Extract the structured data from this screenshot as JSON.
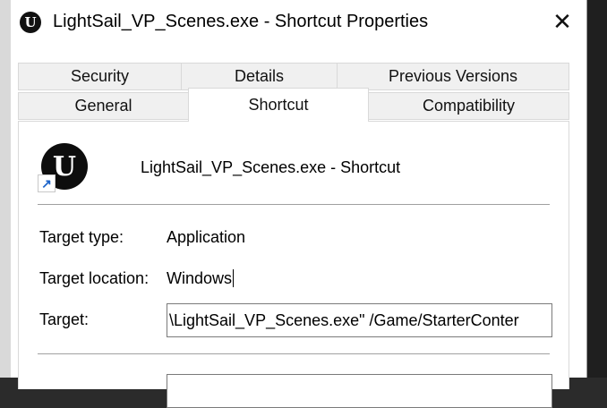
{
  "window": {
    "title": "LightSail_VP_Scenes.exe - Shortcut Properties",
    "close_glyph": "✕"
  },
  "tabs": {
    "row1": [
      "Security",
      "Details",
      "Previous Versions"
    ],
    "row2": [
      "General",
      "Shortcut",
      "Compatibility"
    ],
    "active": "Shortcut"
  },
  "shortcut": {
    "name": "LightSail_VP_Scenes.exe - Shortcut",
    "icon": "unreal-engine-icon",
    "overlay_icon": "shortcut-arrow-icon"
  },
  "fields": {
    "target_type_label": "Target type:",
    "target_type_value": "Application",
    "target_location_label": "Target location:",
    "target_location_value": "Windows",
    "target_label": "Target:",
    "target_value": "\\LightSail_VP_Scenes.exe\" /Game/StarterConter"
  },
  "colors": {
    "shortcut_arrow": "#1c63c9",
    "tab_inactive_bg": "#f0f0f0"
  }
}
